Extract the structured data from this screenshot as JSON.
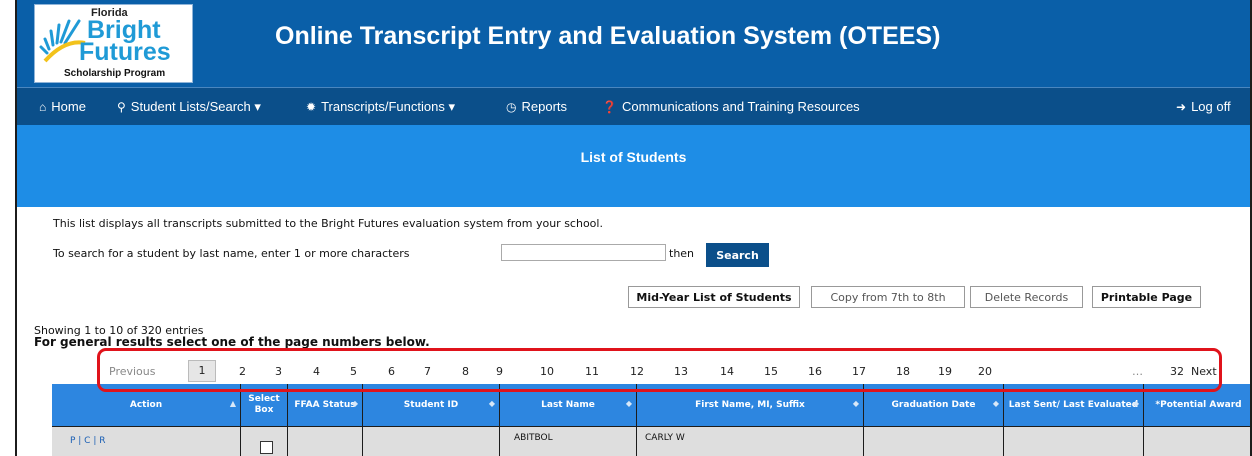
{
  "header": {
    "logo": {
      "florida": "Florida",
      "bright": "Bright",
      "futures": "Futures",
      "program": "Scholarship Program"
    },
    "title": "Online Transcript Entry and Evaluation System (OTEES)"
  },
  "nav": {
    "home": "Home",
    "student_lists": "Student Lists/Search ▾",
    "transcripts": "Transcripts/Functions ▾",
    "reports": "Reports",
    "communications": "Communications and Training Resources",
    "logoff": "Log off"
  },
  "band_title": "List of Students",
  "intro": "This list displays all transcripts submitted to the Bright Futures evaluation system from your school.",
  "search": {
    "prompt": "To search for a student by last name, enter 1 or more characters",
    "value": "",
    "then": "then",
    "button": "Search"
  },
  "actions": {
    "midyear": "Mid-Year List of Students",
    "copy": "Copy from 7th to 8th",
    "delete": "Delete Records",
    "printable": "Printable Page"
  },
  "showing": "Showing 1 to 10 of 320 entries",
  "instructions": "For general results select one of the page numbers below.",
  "pagination": {
    "previous": "Previous",
    "current": "1",
    "pages": [
      "2",
      "3",
      "4",
      "5",
      "6",
      "7",
      "8",
      "9",
      "10",
      "11",
      "12",
      "13",
      "14",
      "15",
      "16",
      "17",
      "18",
      "19",
      "20"
    ],
    "ellipsis": "…",
    "last": "32",
    "next": "Next"
  },
  "table": {
    "headers": [
      "Action",
      "Select Box",
      "FFAA Status",
      "Student ID",
      "Last Name",
      "First Name, MI, Suffix",
      "Graduation Date",
      "Last Sent/ Last Evaluated",
      "*Potential Award"
    ],
    "rows": [
      {
        "action": "P | C | R",
        "ffaa": "",
        "student_id": "",
        "last_name": "ABITBOL",
        "first_name": "CARLY W",
        "grad_date": "",
        "last_sent": "",
        "award": ""
      }
    ]
  }
}
